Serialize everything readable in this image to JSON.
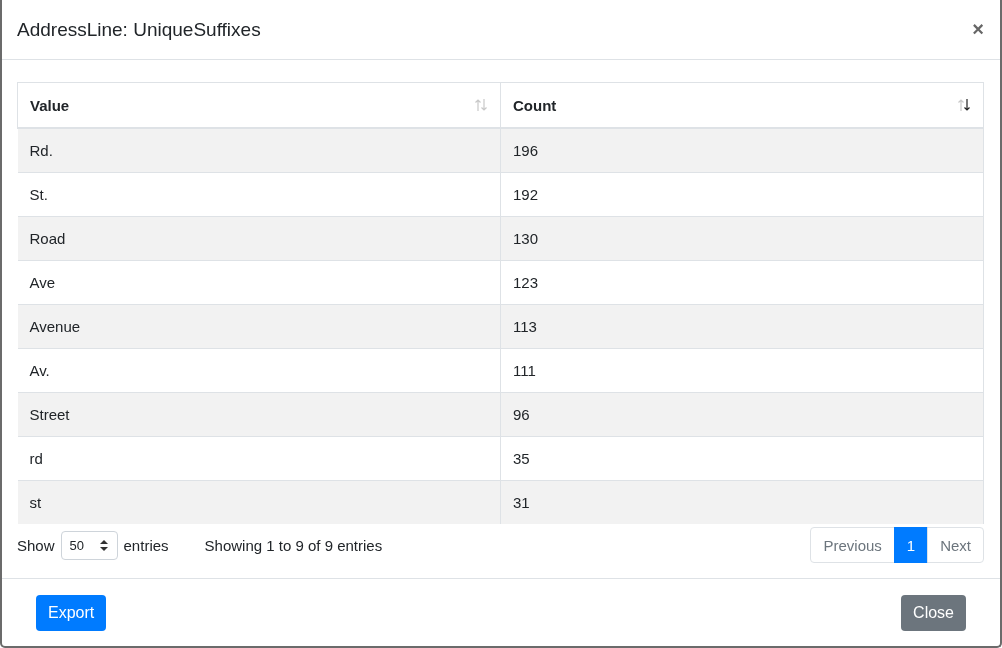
{
  "dialog": {
    "title": "AddressLine: UniqueSuffixes",
    "close_glyph": "×"
  },
  "table": {
    "columns": [
      {
        "label": "Value",
        "sorted_descending": false
      },
      {
        "label": "Count",
        "sorted_descending": true
      }
    ],
    "rows": [
      [
        "Rd.",
        "196"
      ],
      [
        "St.",
        "192"
      ],
      [
        "Road",
        "130"
      ],
      [
        "Ave",
        "123"
      ],
      [
        "Avenue",
        "113"
      ],
      [
        "Av.",
        "111"
      ],
      [
        "Street",
        "96"
      ],
      [
        "rd",
        "35"
      ],
      [
        "st",
        "31"
      ]
    ]
  },
  "length_menu": {
    "before": "Show",
    "value": "50",
    "after": "entries"
  },
  "info": "Showing 1 to 9 of 9 entries",
  "pagination": [
    {
      "label": "Previous",
      "selected": false
    },
    {
      "label": "1",
      "selected": true
    },
    {
      "label": "Next",
      "selected": false
    }
  ],
  "footer": {
    "buttons": [
      {
        "label": "Export",
        "kind": "primary"
      },
      {
        "label": "Close",
        "kind": "secondary"
      }
    ]
  }
}
